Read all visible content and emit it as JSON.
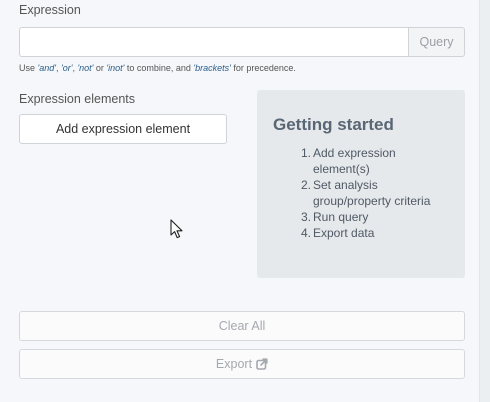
{
  "expression": {
    "label": "Expression",
    "input_value": "",
    "input_placeholder": "",
    "query_label": "Query",
    "help": {
      "prefix": "Use ",
      "and": "'and'",
      "sep1": ", ",
      "or": "'or'",
      "sep2": ", ",
      "not": "'not'",
      "sep3": " or ",
      "inot": "'inot'",
      "mid": " to combine, and ",
      "brackets": "'brackets'",
      "suffix": " for precedence."
    }
  },
  "elements": {
    "label": "Expression elements",
    "add_label": "Add expression element"
  },
  "getting_started": {
    "title": "Getting started",
    "steps": [
      {
        "num": "1.",
        "text": "Add expression element(s)"
      },
      {
        "num": "2.",
        "text": "Set analysis group/property criteria"
      },
      {
        "num": "3.",
        "text": "Run query"
      },
      {
        "num": "4.",
        "text": "Export data"
      }
    ]
  },
  "actions": {
    "clear_label": "Clear All",
    "export_label": "Export"
  },
  "icons": {
    "export": "external-link-icon",
    "cursor": "mouse-pointer-icon"
  },
  "colors": {
    "panel_bg": "#e6e9ec",
    "keyword": "#2a5d8a",
    "disabled_text": "#a4a9ae"
  }
}
